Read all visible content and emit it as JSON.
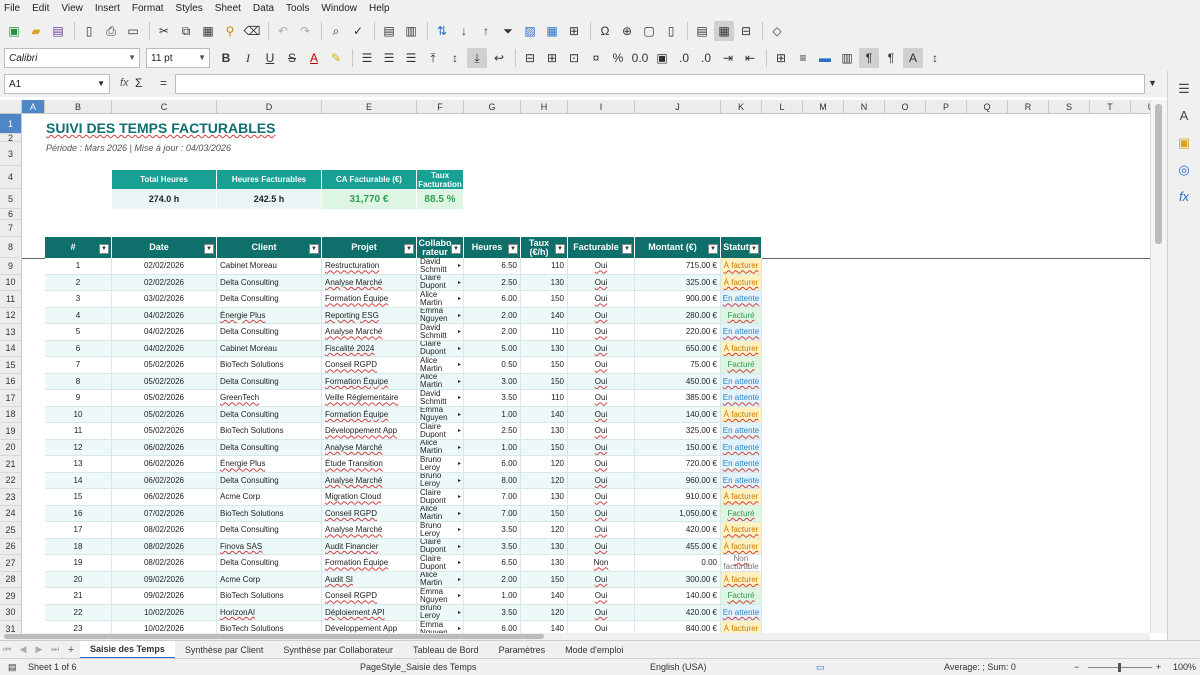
{
  "menu": [
    "File",
    "Edit",
    "View",
    "Insert",
    "Format",
    "Styles",
    "Sheet",
    "Data",
    "Tools",
    "Window",
    "Help"
  ],
  "font": {
    "name": "Calibri",
    "size": "11 pt"
  },
  "namebox": "A1",
  "formula": {
    "fx": "fx",
    "sum": "Σ",
    "eq": "="
  },
  "columns": [
    "A",
    "B",
    "C",
    "D",
    "E",
    "F",
    "G",
    "H",
    "I",
    "J",
    "K",
    "L",
    "M",
    "N",
    "O",
    "P",
    "Q",
    "R",
    "S",
    "T",
    "U"
  ],
  "rows": [
    "1",
    "2",
    "3",
    "4",
    "5",
    "6",
    "7",
    "8",
    "9",
    "10",
    "11",
    "12",
    "13",
    "14",
    "15",
    "16",
    "17",
    "18",
    "19",
    "20",
    "21",
    "22",
    "23",
    "24",
    "25",
    "26",
    "27",
    "28",
    "29",
    "30",
    "31"
  ],
  "title": "SUIVI DES TEMPS FACTURABLES",
  "subtitle": "Période : Mars 2026  |  Mise à jour : 04/03/2026",
  "kpi": {
    "h1": "Total Heures",
    "h2": "Heures Facturables",
    "h3": "CA Facturable (€)",
    "h4a": "Taux",
    "h4b": "Facturation",
    "v1": "274.0 h",
    "v2": "242.5 h",
    "v3": "31,770 €",
    "v4": "88.5 %"
  },
  "headers": [
    "#",
    "Date",
    "Client",
    "Projet",
    "Collabo rateur",
    "Heures",
    "Taux (€/h)",
    "Facturable",
    "Montant (€)",
    "Statut"
  ],
  "table": [
    [
      "1",
      "02/02/2026",
      "Cabinet Moreau",
      "Restructuration",
      "David Schmitt",
      "6.50",
      "110",
      "Oui",
      "715.00 €",
      "À facturer"
    ],
    [
      "2",
      "02/02/2026",
      "Delta Consulting",
      "Analyse Marché",
      "Claire Dupont",
      "2.50",
      "130",
      "Oui",
      "325.00 €",
      "À facturer"
    ],
    [
      "3",
      "03/02/2026",
      "Delta Consulting",
      "Formation Équipe",
      "Alice Martin",
      "6.00",
      "150",
      "Oui",
      "900.00 €",
      "En attente"
    ],
    [
      "4",
      "04/02/2026",
      "Énergie Plus",
      "Reporting ESG",
      "Emma Nguyen",
      "2.00",
      "140",
      "Oui",
      "280.00 €",
      "Facturé"
    ],
    [
      "5",
      "04/02/2026",
      "Delta Consulting",
      "Analyse Marché",
      "David Schmitt",
      "2.00",
      "110",
      "Oui",
      "220.00 €",
      "En attente"
    ],
    [
      "6",
      "04/02/2026",
      "Cabinet Moreau",
      "Fiscalité 2024",
      "Claire Dupont",
      "5.00",
      "130",
      "Oui",
      "650.00 €",
      "À facturer"
    ],
    [
      "7",
      "05/02/2026",
      "BioTech Solutions",
      "Conseil RGPD",
      "Alice Martin",
      "0.50",
      "150",
      "Oui",
      "75.00 €",
      "Facturé"
    ],
    [
      "8",
      "05/02/2026",
      "Delta Consulting",
      "Formation Équipe",
      "Alice Martin",
      "3.00",
      "150",
      "Oui",
      "450.00 €",
      "En attente"
    ],
    [
      "9",
      "05/02/2026",
      "GreenTech",
      "Veille Réglementaire",
      "David Schmitt",
      "3.50",
      "110",
      "Oui",
      "385.00 €",
      "En attente"
    ],
    [
      "10",
      "05/02/2026",
      "Delta Consulting",
      "Formation Équipe",
      "Emma Nguyen",
      "1.00",
      "140",
      "Oui",
      "140.00 €",
      "À facturer"
    ],
    [
      "11",
      "05/02/2026",
      "BioTech Solutions",
      "Développement App",
      "Claire Dupont",
      "2.50",
      "130",
      "Oui",
      "325.00 €",
      "En attente"
    ],
    [
      "12",
      "06/02/2026",
      "Delta Consulting",
      "Analyse Marché",
      "Alice Martin",
      "1.00",
      "150",
      "Oui",
      "150.00 €",
      "En attente"
    ],
    [
      "13",
      "06/02/2026",
      "Énergie Plus",
      "Étude Transition",
      "Bruno Leroy",
      "6.00",
      "120",
      "Oui",
      "720.00 €",
      "En attente"
    ],
    [
      "14",
      "06/02/2026",
      "Delta Consulting",
      "Analyse Marché",
      "Bruno Leroy",
      "8.00",
      "120",
      "Oui",
      "960.00 €",
      "En attente"
    ],
    [
      "15",
      "06/02/2026",
      "Acme Corp",
      "Migration Cloud",
      "Claire Dupont",
      "7.00",
      "130",
      "Oui",
      "910.00 €",
      "À facturer"
    ],
    [
      "16",
      "07/02/2026",
      "BioTech Solutions",
      "Conseil RGPD",
      "Alice Martin",
      "7.00",
      "150",
      "Oui",
      "1,050.00 €",
      "Facturé"
    ],
    [
      "17",
      "08/02/2026",
      "Delta Consulting",
      "Analyse Marché",
      "Bruno Leroy",
      "3.50",
      "120",
      "Oui",
      "420.00 €",
      "À facturer"
    ],
    [
      "18",
      "08/02/2026",
      "Finova SAS",
      "Audit Financier",
      "Claire Dupont",
      "3.50",
      "130",
      "Oui",
      "455.00 €",
      "À facturer"
    ],
    [
      "19",
      "08/02/2026",
      "Delta Consulting",
      "Formation Équipe",
      "Claire Dupont",
      "6.50",
      "130",
      "Non",
      "0.00",
      "Non facturable"
    ],
    [
      "20",
      "09/02/2026",
      "Acme Corp",
      "Audit SI",
      "Alice Martin",
      "2.00",
      "150",
      "Oui",
      "300.00 €",
      "À facturer"
    ],
    [
      "21",
      "09/02/2026",
      "BioTech Solutions",
      "Conseil RGPD",
      "Emma Nguyen",
      "1.00",
      "140",
      "Oui",
      "140.00 €",
      "Facturé"
    ],
    [
      "22",
      "10/02/2026",
      "HorizonAI",
      "Déploiement API",
      "Bruno Leroy",
      "3.50",
      "120",
      "Oui",
      "420.00 €",
      "En attente"
    ],
    [
      "23",
      "10/02/2026",
      "BioTech Solutions",
      "Développement App",
      "Emma Nguyen",
      "6.00",
      "140",
      "Oui",
      "840.00 €",
      "À facturer"
    ]
  ],
  "tabs": [
    "Saisie des Temps",
    "Synthèse par Client",
    "Synthèse par Collaborateur",
    "Tableau de Bord",
    "Paramètres",
    "Mode d'emploi"
  ],
  "status": {
    "sheet": "Sheet 1 of 6",
    "pagestyle": "PageStyle_Saisie des Temps",
    "lang": "English (USA)",
    "agg": "Average: ; Sum: 0",
    "zoom": "100%"
  }
}
